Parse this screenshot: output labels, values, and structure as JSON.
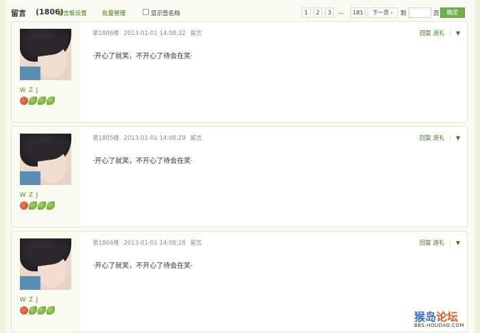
{
  "toolbar": {
    "title": "留言",
    "count": "(1806)",
    "settings_label": "留言板设置",
    "batch_label": "批量管理",
    "show_signature_label": "显示签名档",
    "pages": [
      "1",
      "2",
      "3"
    ],
    "ellipsis": "...",
    "last_page": "181",
    "next_label": "下一页 ›",
    "goto_label": "到",
    "page_suffix": "页",
    "confirm_label": "确定"
  },
  "entries": [
    {
      "username": "W Z J",
      "floor": "第1806楼",
      "time": "2013-01-01 14:08:32",
      "type": "留言",
      "reply": "回复",
      "gift": "送礼",
      "sep": "|",
      "caret": "▼",
      "content": "·开心了就笑，不开心了待会在笑·"
    },
    {
      "username": "W Z J",
      "floor": "第1805楼",
      "time": "2013-01-01 14:08:29",
      "type": "留言",
      "reply": "回复",
      "gift": "送礼",
      "sep": "|",
      "caret": "▼",
      "content": "·开心了就笑，不开心了待会在笑·"
    },
    {
      "username": "W Z J",
      "floor": "第1804楼",
      "time": "2013-01-01 14:08:28",
      "type": "留言",
      "reply": "回复",
      "gift": "送礼",
      "sep": "|",
      "caret": "▼",
      "content": "·开心了就笑，不开心了待会在笑·"
    }
  ],
  "watermark": {
    "logo_main": "猴岛",
    "logo_accent": "论坛",
    "url": "BBS.HOUDAO.COM"
  },
  "colors": {
    "accent_green": "#3d7a12",
    "confirm_button": "#6eb04a",
    "background": "#eef3dc"
  }
}
